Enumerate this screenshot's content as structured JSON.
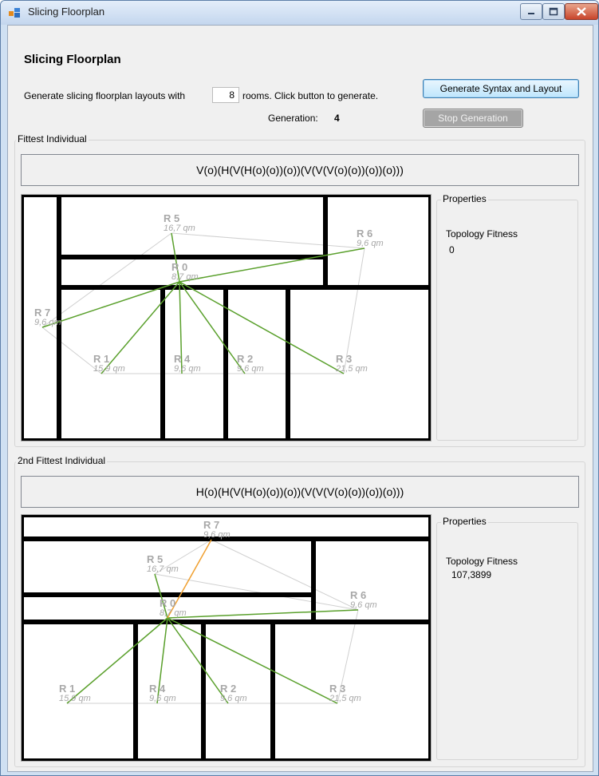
{
  "window": {
    "title": "Slicing Floorplan",
    "icon": "app-window-icon",
    "buttons": [
      "minimize-icon",
      "maximize-icon",
      "close-icon"
    ]
  },
  "header": {
    "heading": "Slicing Floorplan",
    "prompt_prefix": "Generate slicing floorplan layouts with",
    "rooms_value": "8",
    "prompt_suffix": "rooms. Click button to generate.",
    "generation_label": "Generation:",
    "generation_value": "4",
    "generate_button": "Generate Syntax and Layout",
    "stop_button": "Stop Generation"
  },
  "colors": {
    "wall": "#000000",
    "adjacency_edge": "#5aa02c",
    "secondary_edge": "#d0d0d0",
    "highlight_edge": "#f0a030",
    "room_label": "#a8a8a8"
  },
  "panels": [
    {
      "group_title": "Fittest Individual",
      "syntax": "V(o)(H(V(H(o)(o))(o))(V(V(V(o)(o))(o))(o)))",
      "properties_title": "Properties",
      "fitness_label": "Topology Fitness",
      "fitness_value": "0",
      "rooms": [
        {
          "name": "R 5",
          "area": "16,7 qm"
        },
        {
          "name": "R 6",
          "area": "9,6 qm"
        },
        {
          "name": "R 0",
          "area": "8,7 qm"
        },
        {
          "name": "R 7",
          "area": "9,6 qm"
        },
        {
          "name": "R 1",
          "area": "15,9 qm"
        },
        {
          "name": "R 4",
          "area": "9,6 qm"
        },
        {
          "name": "R 2",
          "area": "9,6 qm"
        },
        {
          "name": "R 3",
          "area": "21,5 qm"
        }
      ]
    },
    {
      "group_title": "2nd Fittest Individual",
      "syntax": "H(o)(H(V(H(o)(o))(o))(V(V(V(o)(o))(o))(o)))",
      "properties_title": "Properties",
      "fitness_label": "Topology Fitness",
      "fitness_value": "107,3899",
      "rooms": [
        {
          "name": "R 7",
          "area": "9,6 qm"
        },
        {
          "name": "R 5",
          "area": "16,7 qm"
        },
        {
          "name": "R 6",
          "area": "9,6 qm"
        },
        {
          "name": "R 0",
          "area": "8,7 qm"
        },
        {
          "name": "R 1",
          "area": "15,9 qm"
        },
        {
          "name": "R 4",
          "area": "9,6 qm"
        },
        {
          "name": "R 2",
          "area": "9,6 qm"
        },
        {
          "name": "R 3",
          "area": "21,5 qm"
        }
      ]
    }
  ]
}
